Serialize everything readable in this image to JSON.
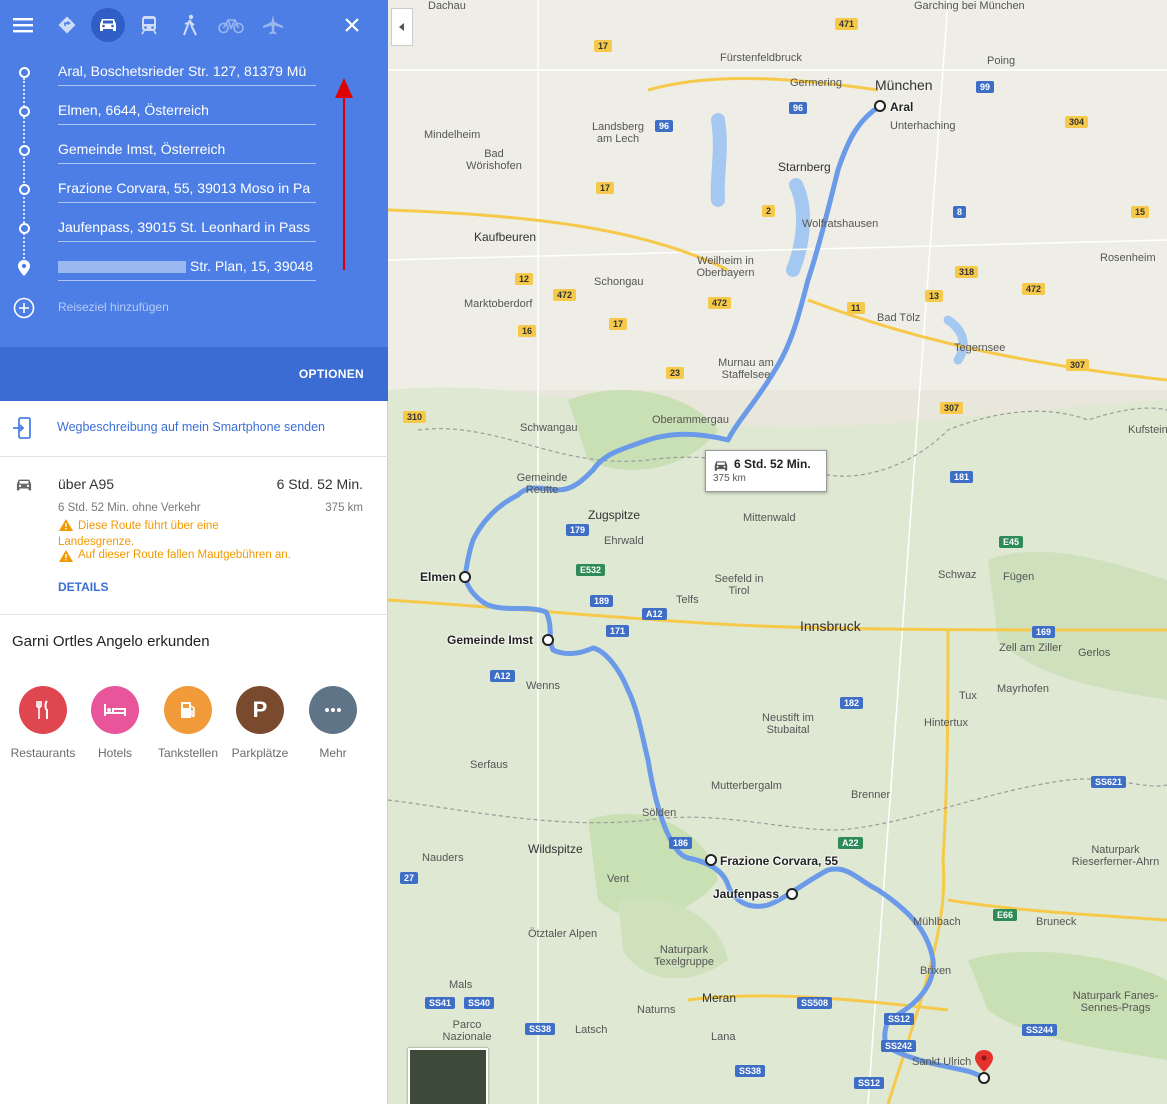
{
  "modes": [
    {
      "name": "menu-icon",
      "active": false
    },
    {
      "name": "directions-best-icon",
      "active": false
    },
    {
      "name": "car-icon",
      "active": true
    },
    {
      "name": "transit-icon",
      "active": false
    },
    {
      "name": "walking-icon",
      "active": false
    },
    {
      "name": "bicycle-icon",
      "active": false
    },
    {
      "name": "flight-icon",
      "active": false
    },
    {
      "name": "close-icon",
      "active": false
    }
  ],
  "stops": [
    "Aral, Boschetsrieder Str. 127, 81379 Mü",
    "Elmen, 6644, Österreich",
    "Gemeinde Imst, Österreich",
    "Frazione Corvara, 55, 39013 Moso in Pa",
    "Jaufenpass, 39015 St. Leonhard in Pass",
    "Str. Plan, 15, 39048"
  ],
  "add_destination": "Reiseziel hinzufügen",
  "options_label": "OPTIONEN",
  "send_to_phone": "Wegbeschreibung auf mein Smartphone senden",
  "route": {
    "via": "über A95",
    "duration": "6 Std. 52 Min.",
    "no_traffic": "6 Std. 52 Min. ohne Verkehr",
    "distance": "375 km",
    "warning_1": "Diese Route führt über eine Landesgrenze.",
    "warning_2": "Auf dieser Route fallen Mautgebühren an.",
    "details": "DETAILS"
  },
  "explore_title": "Garni Ortles Angelo erkunden",
  "categories": [
    {
      "label": "Restaurants",
      "color": "#e0464f",
      "icon": "restaurant-icon"
    },
    {
      "label": "Hotels",
      "color": "#e8559a",
      "icon": "hotel-icon"
    },
    {
      "label": "Tankstellen",
      "color": "#f09a3a",
      "icon": "gas-station-icon"
    },
    {
      "label": "Parkplätze",
      "color": "#7a4a2e",
      "icon": "parking-icon"
    },
    {
      "label": "Mehr",
      "color": "#5f7486",
      "icon": "more-icon"
    }
  ],
  "map": {
    "route_box_duration": "6 Std. 52 Min.",
    "route_box_distance": "375 km",
    "stop_labels": [
      "Aral",
      "Elmen",
      "Gemeinde Imst",
      "Frazione Corvara, 55",
      "Jaufenpass"
    ],
    "places": [
      {
        "t": "München",
        "big": true
      },
      {
        "t": "Dachau"
      },
      {
        "t": "Garching bei München"
      },
      {
        "t": "Fürstenfeldbruck"
      },
      {
        "t": "Germering"
      },
      {
        "t": "Poing"
      },
      {
        "t": "Unterhaching"
      },
      {
        "t": "Mindelheim"
      },
      {
        "t": "Landsberg am Lech"
      },
      {
        "t": "Bad Wörishofen"
      },
      {
        "t": "Starnberg"
      },
      {
        "t": "Wolfratshausen"
      },
      {
        "t": "Kaufbeuren"
      },
      {
        "t": "Weilheim in Oberbayern"
      },
      {
        "t": "Rosenheim"
      },
      {
        "t": "Marktoberdorf"
      },
      {
        "t": "Schongau"
      },
      {
        "t": "Bad Tölz"
      },
      {
        "t": "Tegernsee"
      },
      {
        "t": "Murnau am Staffelsee"
      },
      {
        "t": "Oberammergau"
      },
      {
        "t": "Schwangau"
      },
      {
        "t": "Gemeinde Reutte"
      },
      {
        "t": "Zugspitze"
      },
      {
        "t": "Ehrwald"
      },
      {
        "t": "Mittenwald"
      },
      {
        "t": "Kufstein"
      },
      {
        "t": "Seefeld in Tirol"
      },
      {
        "t": "Telfs"
      },
      {
        "t": "Schwaz"
      },
      {
        "t": "Fügen"
      },
      {
        "t": "Innsbruck",
        "big": true
      },
      {
        "t": "Zell am Ziller"
      },
      {
        "t": "Gerlos"
      },
      {
        "t": "Mayrhofen"
      },
      {
        "t": "Tux"
      },
      {
        "t": "Hintertux"
      },
      {
        "t": "Neustift im Stubaital"
      },
      {
        "t": "Wenns"
      },
      {
        "t": "Serfaus"
      },
      {
        "t": "Mutterbergalm"
      },
      {
        "t": "Brenner"
      },
      {
        "t": "Sölden"
      },
      {
        "t": "Nauders"
      },
      {
        "t": "Wildspitze"
      },
      {
        "t": "Vent"
      },
      {
        "t": "Naturpark Rieserferner-Ahrn"
      },
      {
        "t": "Mühlbach"
      },
      {
        "t": "Bruneck"
      },
      {
        "t": "Ötztaler Alpen"
      },
      {
        "t": "Naturpark Texelgruppe"
      },
      {
        "t": "Brixen"
      },
      {
        "t": "Mals"
      },
      {
        "t": "Meran"
      },
      {
        "t": "Naturns"
      },
      {
        "t": "Naturpark Fanes-Sennes-Prags"
      },
      {
        "t": "Parco Nazionale"
      },
      {
        "t": "Latsch"
      },
      {
        "t": "Lana"
      },
      {
        "t": "Sankt Ulrich"
      }
    ],
    "shields": [
      "471",
      "17",
      "96",
      "99",
      "304",
      "96",
      "17",
      "2",
      "8",
      "15",
      "12",
      "472",
      "318",
      "472",
      "16",
      "17",
      "472",
      "11",
      "13",
      "307",
      "23",
      "307",
      "310",
      "181",
      "179",
      "E532",
      "189",
      "A12",
      "171",
      "E45",
      "169",
      "A12",
      "182",
      "186",
      "A22",
      "SS621",
      "27",
      "E66",
      "SS41",
      "SS40",
      "SS38",
      "SS38",
      "SS508",
      "SS12",
      "SS242",
      "SS12",
      "SS244"
    ]
  }
}
